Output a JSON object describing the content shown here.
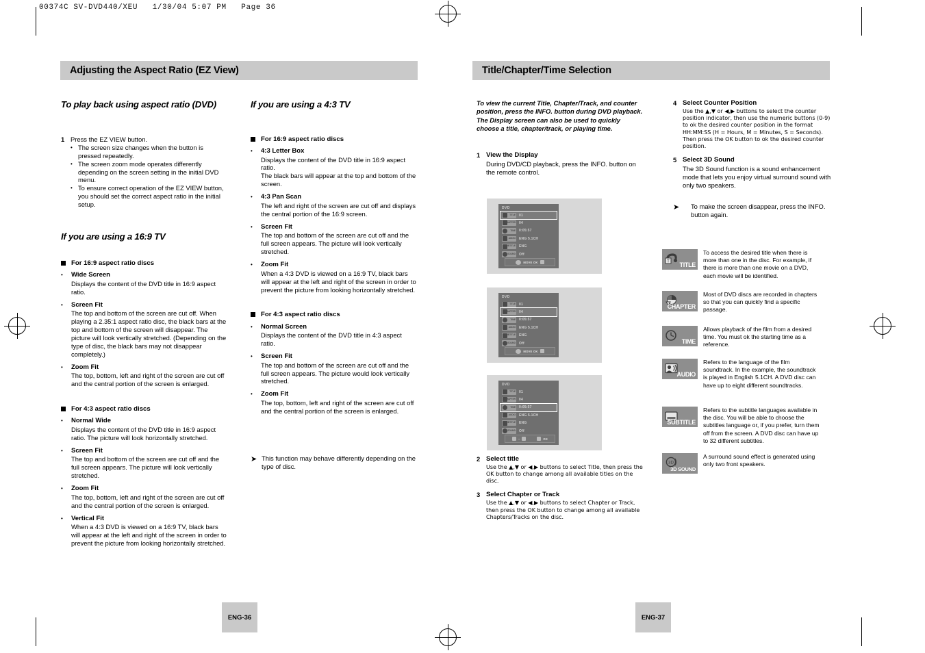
{
  "file_header": "00374C SV-DVD440/XEU   1/30/04 5:07 PM   Page 36",
  "left_page": {
    "banner_title": "Adjusting the Aspect Ratio (EZ View)",
    "page_number": "ENG-36",
    "col1": {
      "heading_1": "To play back using aspect ratio (DVD)",
      "step1_num": "1",
      "step1_title": "Press the EZ VIEW button.",
      "step1_bullets": [
        "The screen size changes when the button is pressed repeatedly.",
        "The screen zoom mode operates differently depending on the screen setting in the initial DVD menu.",
        "To ensure correct operation of the EZ VIEW button, you should set the correct aspect ratio in the initial setup."
      ],
      "heading_2": "If you are using a 16:9 TV",
      "group_169_head": "For 16:9 aspect ratio discs",
      "group_169_items": [
        {
          "term": "Wide Screen",
          "desc": "Displays the content of the DVD title in 16:9 aspect ratio."
        },
        {
          "term": "Screen Fit",
          "desc": "The top and bottom of the screen are cut off. When playing a 2.35:1 aspect ratio disc, the black bars at the top and bottom of the screen will disappear. The picture will look vertically stretched. (Depending on the type of disc, the black bars may not disappear completely.)"
        },
        {
          "term": "Zoom Fit",
          "desc": "The top, bottom, left and right of the screen are cut off and the central portion of the screen is enlarged."
        }
      ],
      "group_43_head": "For 4:3 aspect ratio discs",
      "group_43_items": [
        {
          "term": "Normal Wide",
          "desc": "Displays the content of the DVD title in 16:9 aspect ratio. The picture will look horizontally stretched."
        },
        {
          "term": "Screen Fit",
          "desc": "The top and bottom of the screen are cut off and the full screen appears. The picture will look vertically stretched."
        },
        {
          "term": "Zoom Fit",
          "desc": "The top, bottom, left and right of the screen are cut off and the central portion of the screen is enlarged."
        },
        {
          "term": "Vertical Fit",
          "desc": "When a 4:3 DVD is viewed on a 16:9 TV, black bars will appear at the left and right of the screen in order to prevent the picture from looking horizontally stretched."
        }
      ]
    },
    "col2": {
      "heading_1": "If you are using a 4:3 TV",
      "group_169_head": "For 16:9 aspect ratio discs",
      "group_169_items": [
        {
          "term": "4:3 Letter Box",
          "desc": "Displays the content of the DVD title in 16:9 aspect ratio.\nThe black bars will appear at the top and bottom of the screen."
        },
        {
          "term": "4:3 Pan Scan",
          "desc": "The left and right of the screen are cut off and displays the central portion of the 16:9 screen."
        },
        {
          "term": "Screen Fit",
          "desc": "The top and bottom of the screen are cut off and the full screen appears. The picture will look vertically stretched."
        },
        {
          "term": "Zoom Fit",
          "desc": "When a 4:3 DVD is viewed on a 16:9 TV, black bars will appear at the left and right of the screen in order to prevent the picture from looking horizontally stretched."
        }
      ],
      "group_43_head": "For 4:3 aspect ratio discs",
      "group_43_items": [
        {
          "term": "Normal Screen",
          "desc": "Displays the content of the DVD title in 4:3 aspect ratio."
        },
        {
          "term": "Screen Fit",
          "desc": "The top and bottom of the screen are cut off and the full screen appears. The picture would look vertically stretched."
        },
        {
          "term": "Zoom Fit",
          "desc": "The top, bottom, left and right of the screen are cut off and the central portion of the screen is enlarged."
        }
      ],
      "note": "This function may behave differently depending on the type of disc."
    }
  },
  "right_page": {
    "banner_title": "Title/Chapter/Time Selection",
    "page_number": "ENG-37",
    "intro": "To view the current Title, Chapter/Track, and counter position, press the INFO. button during DVD playback. The Display screen can also be used to quickly choose a title, chapter/track, or playing time.",
    "steps": [
      {
        "num": "1",
        "title": "View the Display",
        "text": "During DVD/CD playback, press the INFO. button on the remote control."
      },
      {
        "num": "2",
        "title": "Select title",
        "text": "Use the ▲,▼ or ◀,▶ buttons to select Title, then press the OK button to change among all available titles on the disc."
      },
      {
        "num": "3",
        "title": "Select Chapter or Track",
        "text": "Use the ▲,▼ or ◀,▶ buttons to select Chapter or Track, then press the OK button to change among all available Chapters/Tracks on the disc."
      },
      {
        "num": "4",
        "title": "Select Counter Position",
        "text": "Use the ▲,▼ or ◀,▶ buttons to select the counter position indicator, then use the numeric buttons (0-9) to ok the desired counter position in the format HH:MM:SS (H = Hours, M = Minutes, S = Seconds). Then press the OK button to ok the desired counter position."
      },
      {
        "num": "5",
        "title": "Select 3D Sound",
        "text": "The 3D Sound function is a sound enhancement mode that lets you enjoy virtual surround sound with only two speakers."
      }
    ],
    "note": "To make the screen disappear, press the INFO. button again.",
    "osd_screens": [
      {
        "disc_label": "DVD",
        "highlight": 0,
        "footer": "MOVE   OK",
        "footer_mode": "move",
        "rows": [
          {
            "chip": "TITLE",
            "value": "01"
          },
          {
            "chip": "CHAPTER",
            "value": "04"
          },
          {
            "chip": "TIME",
            "value": "0:05:57"
          },
          {
            "chip": "AUDIO",
            "value": "ENG 5.1CH"
          },
          {
            "chip": "SUBTITLE",
            "value": "ENG"
          },
          {
            "chip": "3D SOUND",
            "value": "Off"
          }
        ]
      },
      {
        "disc_label": "DVD",
        "highlight": 1,
        "footer": "MOVE   OK",
        "footer_mode": "move",
        "rows": [
          {
            "chip": "TITLE",
            "value": "01"
          },
          {
            "chip": "CHAPTER",
            "value": "04"
          },
          {
            "chip": "TIME",
            "value": "0:05:57"
          },
          {
            "chip": "AUDIO",
            "value": "ENG 5.1CH"
          },
          {
            "chip": "SUBTITLE",
            "value": "ENG"
          },
          {
            "chip": "3D SOUND",
            "value": "Off"
          }
        ]
      },
      {
        "disc_label": "DVD",
        "highlight": 2,
        "footer": "OK",
        "footer_mode": "numeric",
        "rows": [
          {
            "chip": "TITLE",
            "value": "01"
          },
          {
            "chip": "CHAPTER",
            "value": "04"
          },
          {
            "chip": "TIME",
            "value": "0:05:57"
          },
          {
            "chip": "AUDIO",
            "value": "ENG 5.1CH"
          },
          {
            "chip": "SUBTITLE",
            "value": "ENG"
          },
          {
            "chip": "3D SOUND",
            "value": "Off"
          }
        ]
      }
    ],
    "glossary": [
      {
        "icon": "title-icon",
        "label": "TITLE",
        "text": "To access the desired title when there is more than one in the disc. For example, if there is more than one movie on a DVD, each movie will be identified."
      },
      {
        "icon": "chapter-icon",
        "label": "CHAPTER",
        "text": "Most of DVD discs are recorded in chapters so that you can quickly find a specific passage."
      },
      {
        "icon": "time-icon",
        "label": "TIME",
        "text": "Allows playback of the film from a desired time. You must ok the starting time as a reference."
      },
      {
        "icon": "audio-icon",
        "label": "AUDIO",
        "text": "Refers to the language of the film soundtrack. In the example, the soundtrack is played in English 5.1CH. A DVD disc can have up to eight different soundtracks."
      },
      {
        "icon": "subtitle-icon",
        "label": "SUBTITLE",
        "text": "Refers to the subtitle languages available in the disc. You will be able to choose the subtitles language or, if you prefer, turn them off from the screen. A DVD disc can have up to 32 different subtitles."
      },
      {
        "icon": "3d-sound-icon",
        "label": "3D SOUND",
        "text": "A surround sound effect is generated using only two front speakers."
      }
    ]
  },
  "colors": {
    "banner_bg": "#c9c9c9",
    "icon_bg": "#8e8e8e",
    "osd_bg": "#6f6f6f",
    "osd_outer": "#d8d8d8"
  }
}
